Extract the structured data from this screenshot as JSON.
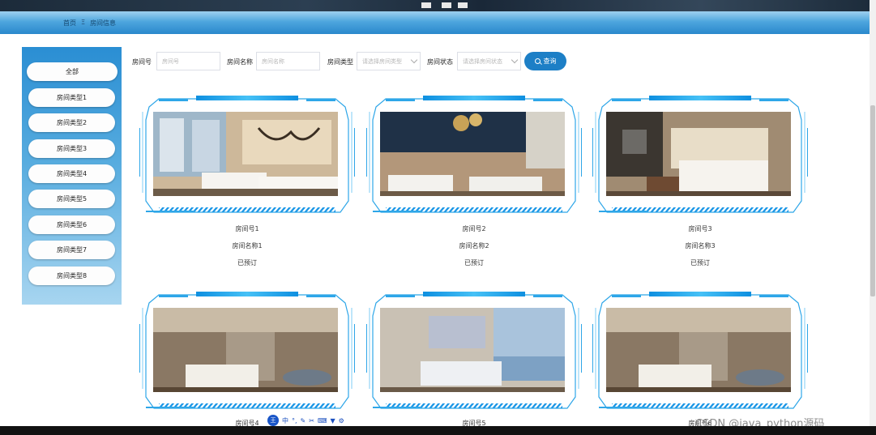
{
  "breadcrumb": {
    "home": "首页",
    "separator": "Ξ",
    "current": "房间信息"
  },
  "sidebar": {
    "items": [
      {
        "label": "全部"
      },
      {
        "label": "房间类型1"
      },
      {
        "label": "房间类型2"
      },
      {
        "label": "房间类型3"
      },
      {
        "label": "房间类型4"
      },
      {
        "label": "房间类型5"
      },
      {
        "label": "房间类型6"
      },
      {
        "label": "房间类型7"
      },
      {
        "label": "房间类型8"
      }
    ]
  },
  "filters": {
    "room_no": {
      "label": "房间号",
      "placeholder": "房间号"
    },
    "room_name": {
      "label": "房间名称",
      "placeholder": "房间名称"
    },
    "room_type": {
      "label": "房间类型",
      "placeholder": "请选择房间类型"
    },
    "room_status": {
      "label": "房间状态",
      "placeholder": "请选择房间状态"
    },
    "search_label": "查询"
  },
  "rooms": [
    {
      "number": "房间号1",
      "name": "房间名称1",
      "status": "已预订"
    },
    {
      "number": "房间号2",
      "name": "房间名称2",
      "status": "已预订"
    },
    {
      "number": "房间号3",
      "name": "房间名称3",
      "status": "已预订"
    },
    {
      "number": "房间号4"
    },
    {
      "number": "房间号5"
    },
    {
      "number": "房间号6"
    }
  ],
  "ime_toolbar": {
    "logo": "王",
    "mode": "中"
  },
  "watermark": "CSDN @java_python源码",
  "colors": {
    "accent": "#1d7fc6",
    "frame": "#2ea6e8",
    "sidebar_top": "#2a8ed3"
  }
}
